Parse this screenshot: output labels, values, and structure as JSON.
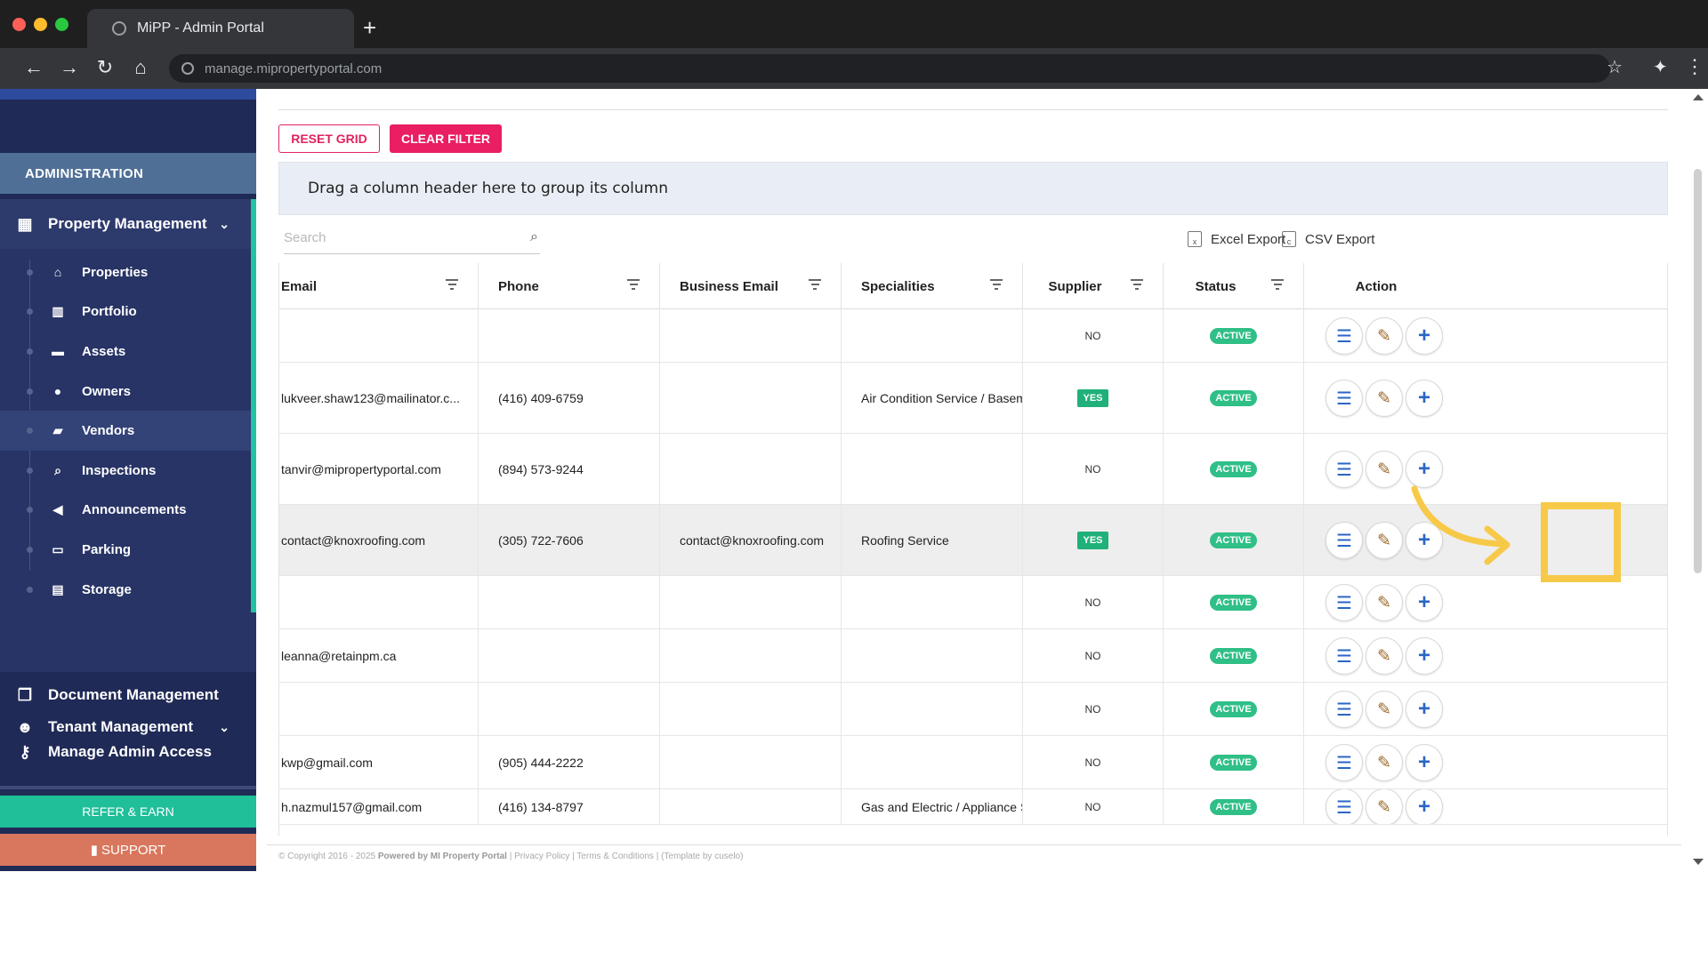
{
  "browser": {
    "tab_title": "MiPP - Admin Portal",
    "url": "manage.mipropertyportal.com"
  },
  "sidebar": {
    "section_header": "ADMINISTRATION",
    "property_management": {
      "label": "Property Management",
      "items": [
        {
          "label": "Properties",
          "icon": "home-icon"
        },
        {
          "label": "Portfolio",
          "icon": "building-icon"
        },
        {
          "label": "Assets",
          "icon": "archive-icon"
        },
        {
          "label": "Owners",
          "icon": "user-icon"
        },
        {
          "label": "Vendors",
          "icon": "briefcase-icon",
          "active": true
        },
        {
          "label": "Inspections",
          "icon": "magnifier-icon"
        },
        {
          "label": "Announcements",
          "icon": "megaphone-icon"
        },
        {
          "label": "Parking",
          "icon": "car-icon"
        },
        {
          "label": "Storage",
          "icon": "basket-icon"
        }
      ]
    },
    "tenant_management": "Tenant Management",
    "document_management": "Document Management",
    "manage_admin_access": "Manage Admin Access",
    "refer_label": "REFER & EARN",
    "support_label": "SUPPORT"
  },
  "toolbar": {
    "reset_grid": "RESET GRID",
    "clear_filter": "CLEAR FILTER",
    "group_panel_text": "Drag a column header here to group its column",
    "search_placeholder": "Search",
    "excel_export": "Excel Export",
    "csv_export": "CSV Export"
  },
  "grid": {
    "columns": [
      "Email",
      "Phone",
      "Business Email",
      "Specialities",
      "Supplier",
      "Status",
      "Action"
    ],
    "rows": [
      {
        "email": "",
        "phone": "",
        "business_email": "",
        "specialities": "",
        "supplier": "NO",
        "status": "ACTIVE"
      },
      {
        "email": "lukveer.shaw123@mailinator.c...",
        "phone": "(416) 409-6759",
        "business_email": "",
        "specialities": "Air Condition Service / Basem...",
        "supplier": "YES",
        "status": "ACTIVE"
      },
      {
        "email": "tanvir@mipropertyportal.com",
        "phone": "(894) 573-9244",
        "business_email": "",
        "specialities": "",
        "supplier": "NO",
        "status": "ACTIVE"
      },
      {
        "email": "contact@knoxroofing.com",
        "phone": "(305) 722-7606",
        "business_email": "contact@knoxroofing.com",
        "specialities": "Roofing Service",
        "supplier": "YES",
        "status": "ACTIVE",
        "highlight": true
      },
      {
        "email": "",
        "phone": "",
        "business_email": "",
        "specialities": "",
        "supplier": "NO",
        "status": "ACTIVE"
      },
      {
        "email": "leanna@retainpm.ca",
        "phone": "",
        "business_email": "",
        "specialities": "",
        "supplier": "NO",
        "status": "ACTIVE"
      },
      {
        "email": "",
        "phone": "",
        "business_email": "",
        "specialities": "",
        "supplier": "NO",
        "status": "ACTIVE"
      },
      {
        "email": "kwp@gmail.com",
        "phone": "(905) 444-2222",
        "business_email": "",
        "specialities": "",
        "supplier": "NO",
        "status": "ACTIVE"
      },
      {
        "email": "h.nazmul157@gmail.com",
        "phone": "(416) 134-8797",
        "business_email": "",
        "specialities": "Gas and Electric / Appliance S...",
        "supplier": "NO",
        "status": "ACTIVE"
      }
    ]
  },
  "footer": {
    "copyright": "© Copyright 2016 - 2025",
    "powered": "Powered by MI Property Portal",
    "links": "| Privacy Policy | Terms & Conditions |",
    "template": "(Template by cuselo)"
  },
  "colors": {
    "sidebar_bg": "#1f2a56",
    "accent_teal": "#22c3a2",
    "reset_pink": "#e91e63",
    "active_green": "#2fbf87",
    "annotation_yellow": "#f7c948"
  }
}
